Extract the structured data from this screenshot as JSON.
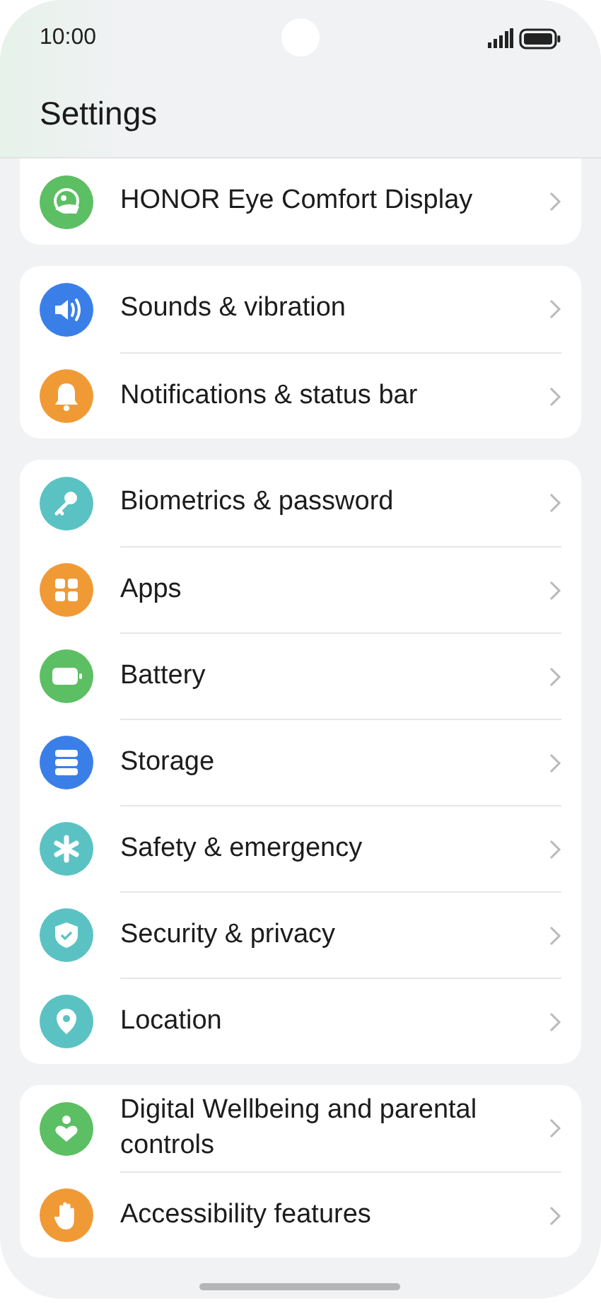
{
  "status_bar": {
    "time": "10:00"
  },
  "title": "Settings",
  "groups": [
    {
      "cut_top": true,
      "items": [
        {
          "label": "HONOR Eye Comfort Display",
          "kind": "eye",
          "color": "#5cbf63"
        }
      ]
    },
    {
      "cut_top": false,
      "items": [
        {
          "label": "Sounds & vibration",
          "kind": "sound",
          "color": "#3a7fe8"
        },
        {
          "label": "Notifications & status bar",
          "kind": "bell",
          "color": "#f09a36"
        }
      ]
    },
    {
      "cut_top": false,
      "items": [
        {
          "label": "Biometrics & password",
          "kind": "key",
          "color": "#5bc2c3"
        },
        {
          "label": "Apps",
          "kind": "apps",
          "color": "#f09a36"
        },
        {
          "label": "Battery",
          "kind": "battery",
          "color": "#5cbf63"
        },
        {
          "label": "Storage",
          "kind": "storage",
          "color": "#3a7fe8"
        },
        {
          "label": "Safety & emergency",
          "kind": "asterisk",
          "color": "#5bc2c3"
        },
        {
          "label": "Security & privacy",
          "kind": "shield",
          "color": "#5bc2c3"
        },
        {
          "label": "Location",
          "kind": "pin",
          "color": "#5bc2c3"
        }
      ]
    },
    {
      "cut_top": false,
      "items": [
        {
          "label": "Digital Wellbeing and parental controls",
          "kind": "wellbeing",
          "color": "#5cbf63"
        },
        {
          "label": "Accessibility features",
          "kind": "hand",
          "color": "#f09a36"
        }
      ]
    }
  ]
}
